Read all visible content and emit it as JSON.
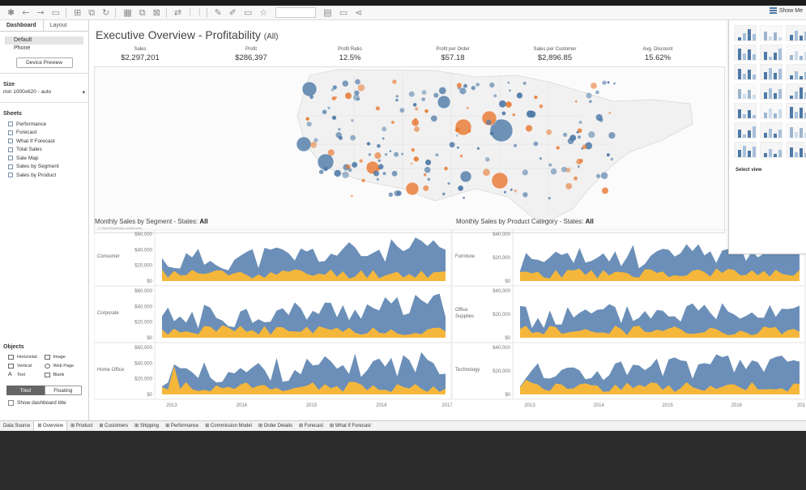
{
  "toolbar": {
    "icons": [
      "tableau-logo-icon",
      "back-icon",
      "forward-icon",
      "save-icon",
      "new-datasource-icon",
      "pause-icon",
      "refresh-icon",
      "new-sheet-icon",
      "duplicate-icon",
      "clear-icon",
      "swap-icon",
      "sort-asc-icon",
      "sort-desc-icon",
      "highlight-icon",
      "group-icon",
      "label-icon",
      "fix-axes-icon",
      "fit-icon",
      "present-icon",
      "share-icon"
    ],
    "show_me_label": "Show Me"
  },
  "left_panel": {
    "tabs": [
      "Dashboard",
      "Layout"
    ],
    "device_options": [
      "Default",
      "Phone"
    ],
    "device_preview_label": "Device Preview",
    "size_heading": "Size",
    "size_value": "min 1000x620 - auto",
    "sheets_heading": "Sheets",
    "sheets": [
      "Performance",
      "Forecast",
      "What If Forecast",
      "Total Sales",
      "Sale Map",
      "Sales by Segment",
      "Sales by Product"
    ],
    "objects_heading": "Objects",
    "objects": [
      "Horizontal",
      "Image",
      "Vertical",
      "Web Page",
      "Text",
      "Blank"
    ],
    "tiled_label": "Tiled",
    "floating_label": "Floating",
    "show_title_label": "Show dashboard title"
  },
  "dashboard": {
    "title": "Executive Overview - Profitability",
    "title_suffix": "(All)",
    "kpis": [
      {
        "label": "Sales",
        "value": "$2,297,201"
      },
      {
        "label": "Profit",
        "value": "$286,397"
      },
      {
        "label": "Profit Ratio",
        "value": "12.5%"
      },
      {
        "label": "Profit per Order",
        "value": "$57.18"
      },
      {
        "label": "Sales per Customer",
        "value": "$2,896.85"
      },
      {
        "label": "Avg. Discount",
        "value": "15.62%"
      }
    ],
    "map_credit": "© OpenStreetMap contributors",
    "segment_chart": {
      "title": "Monthly Sales by Segment - States:",
      "filter": "All",
      "rows": [
        "Consumer",
        "Corporate",
        "Home Office"
      ],
      "y_ticks": [
        "$60,000",
        "$40,000",
        "$20,000",
        "$0"
      ],
      "x_ticks": [
        "2013",
        "2014",
        "2015",
        "2016",
        "2017"
      ]
    },
    "category_chart": {
      "title": "Monthly Sales by Product Category - States:",
      "filter": "All",
      "rows": [
        "Furniture",
        "Office Supplies",
        "Technology"
      ],
      "y_ticks": [
        "$40,000",
        "$20,000",
        "$0"
      ],
      "x_ticks": [
        "2013",
        "2014",
        "2015",
        "2016",
        "201"
      ]
    },
    "colors": {
      "sales": "#6b8fb8",
      "profit": "#f5b73b",
      "map_blue": "#4e79a7",
      "map_orange": "#e8772e"
    }
  },
  "show_me": {
    "select_view_label": "Select view"
  },
  "bottom_tabs": [
    "Data Source",
    "Overview",
    "Product",
    "Customers",
    "Shipping",
    "Performance",
    "Commission Model",
    "Order Details",
    "Forecast",
    "What If Forecast"
  ],
  "active_tab": "Overview"
}
